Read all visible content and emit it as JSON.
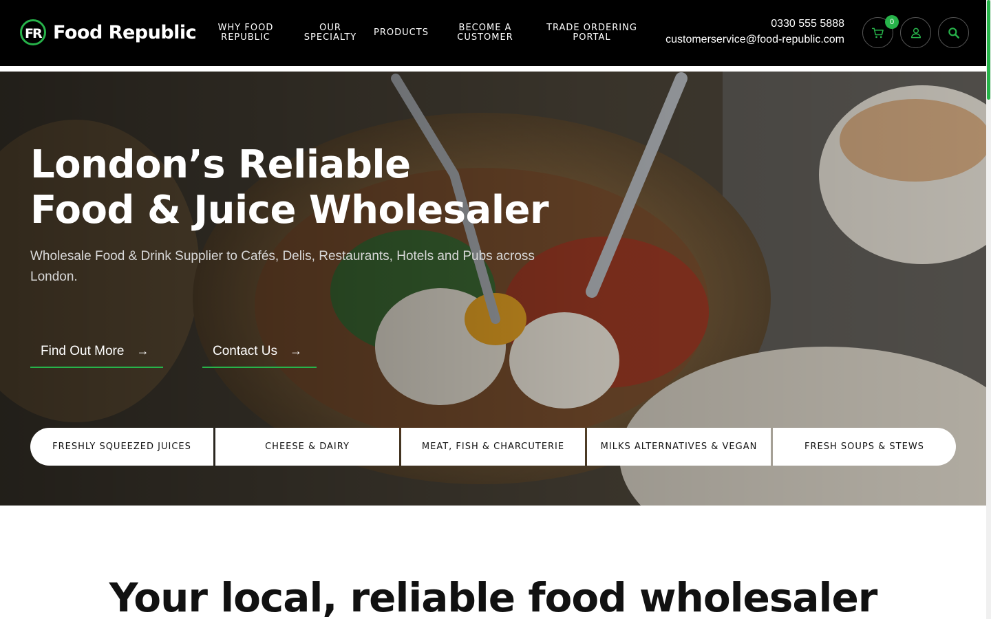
{
  "brand": {
    "name": "Food Republic",
    "accent_color": "#27b34a"
  },
  "nav": {
    "items": [
      {
        "line1": "WHY FOOD",
        "line2": "REPUBLIC"
      },
      {
        "line1": "OUR",
        "line2": "SPECIALTY"
      },
      {
        "line1": "PRODUCTS",
        "line2": ""
      },
      {
        "line1": "BECOME A",
        "line2": "CUSTOMER"
      },
      {
        "line1": "TRADE ORDERING",
        "line2": "PORTAL"
      }
    ]
  },
  "contact": {
    "phone": "0330 555 5888",
    "email": "customerservice@food-republic.com"
  },
  "header_icons": {
    "cart_count": "0",
    "cart_icon": "cart-icon",
    "account_icon": "user-icon",
    "search_icon": "search-icon"
  },
  "hero": {
    "title_line1": "London’s Reliable",
    "title_line2": "Food & Juice Wholesaler",
    "subtitle": "Wholesale Food & Drink Supplier to Cafés, Delis, Restaurants, Hotels and Pubs across London.",
    "cta_primary": "Find Out More",
    "cta_secondary": "Contact Us",
    "cta_arrow": "→"
  },
  "categories": [
    "FRESHLY SQUEEZED JUICES",
    "CHEESE & DAIRY",
    "MEAT, FISH & CHARCUTERIE",
    "MILKS ALTERNATIVES & VEGAN",
    "FRESH SOUPS & STEWS"
  ],
  "intro": {
    "heading": "Your local, reliable food wholesaler"
  }
}
